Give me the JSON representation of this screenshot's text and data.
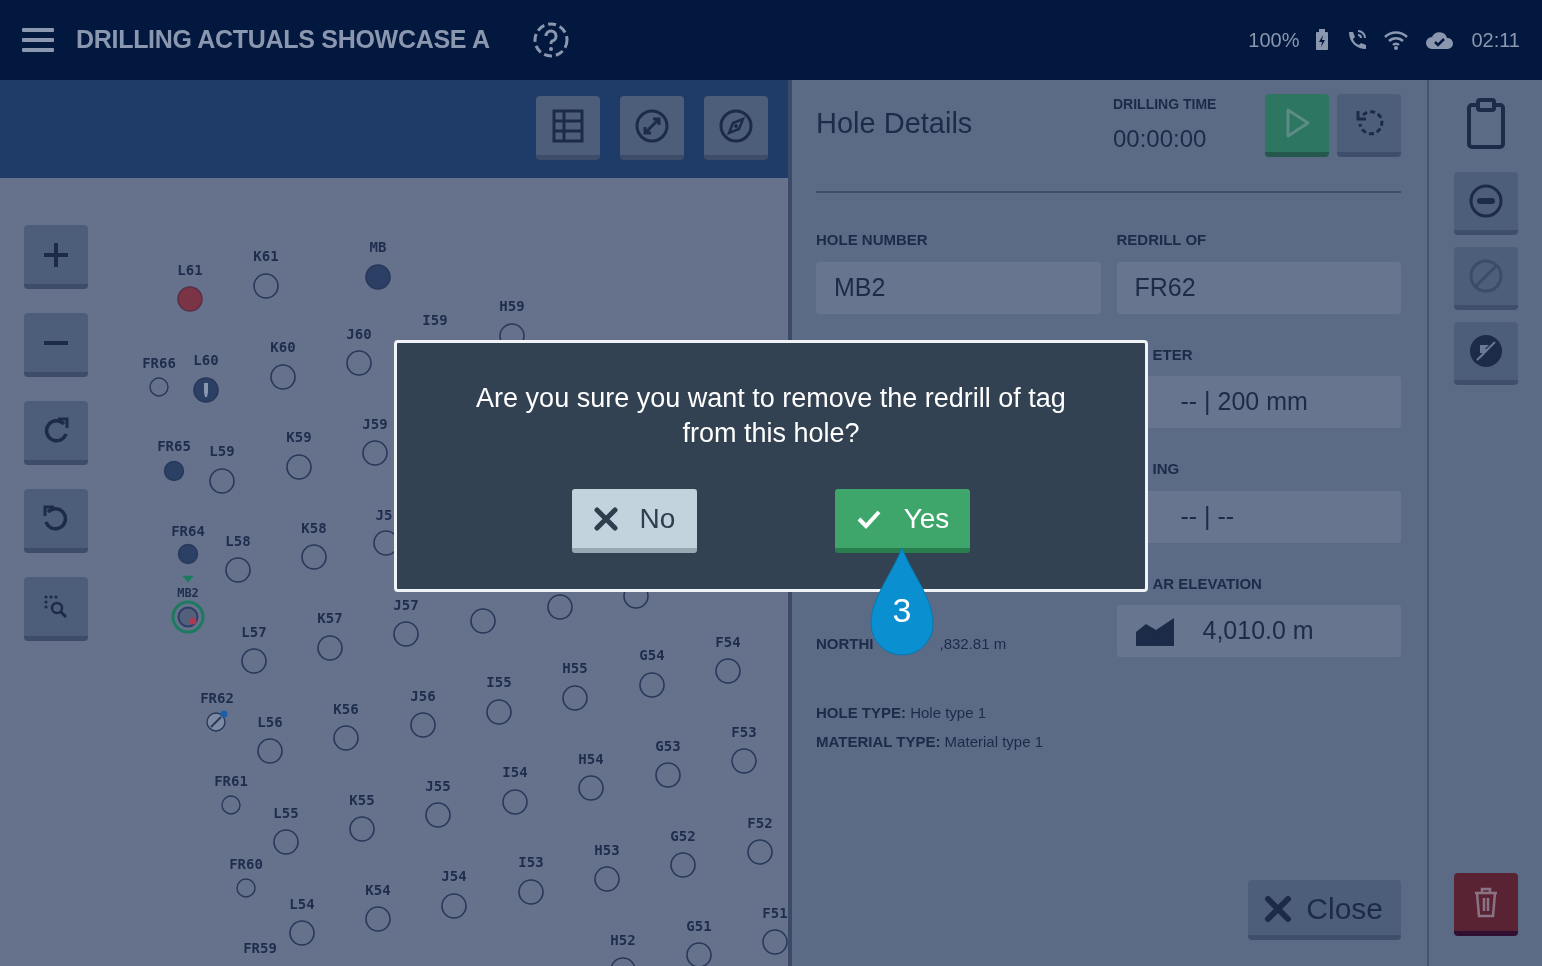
{
  "top_bar": {
    "title": "DRILLING ACTUALS SHOWCASE A",
    "battery": "100%",
    "time": "02:11"
  },
  "map": {
    "holes": [
      {
        "label": "MB",
        "kind": "drilled",
        "selected": false
      },
      {
        "label": "K61",
        "kind": "planned",
        "selected": false
      },
      {
        "label": "L61",
        "kind": "problem",
        "selected": false
      },
      {
        "label": "H59",
        "kind": "planned",
        "selected": false
      },
      {
        "label": "I59",
        "kind": "hidden",
        "selected": false
      },
      {
        "label": "J60",
        "kind": "planned",
        "selected": false
      },
      {
        "label": "K60",
        "kind": "planned",
        "selected": false
      },
      {
        "label": "L60",
        "kind": "flagged",
        "selected": false
      },
      {
        "label": "FR66",
        "kind": "small",
        "selected": false
      },
      {
        "label": "J59",
        "kind": "planned",
        "selected": false
      },
      {
        "label": "K59",
        "kind": "planned",
        "selected": false
      },
      {
        "label": "FR65",
        "kind": "small-drilled",
        "selected": false
      },
      {
        "label": "L59",
        "kind": "planned",
        "selected": false
      },
      {
        "label": "J5",
        "kind": "planned",
        "selected": false
      },
      {
        "label": "K58",
        "kind": "planned",
        "selected": false
      },
      {
        "label": "FR64",
        "kind": "small-drilled",
        "selected": false
      },
      {
        "label": "L58",
        "kind": "planned",
        "selected": false
      },
      {
        "label": "MB2",
        "kind": "redrilled",
        "selected": true
      },
      {
        "kind": "planned",
        "selected": false
      },
      {
        "label": "J57",
        "kind": "planned",
        "selected": false
      },
      {
        "kind": "planned",
        "selected": false
      },
      {
        "label": "K57",
        "kind": "planned",
        "selected": false
      },
      {
        "kind": "planned",
        "selected": false
      },
      {
        "label": "L57",
        "kind": "planned",
        "selected": false
      },
      {
        "label": "F54",
        "kind": "planned",
        "selected": false
      },
      {
        "label": "G54",
        "kind": "planned",
        "selected": false
      },
      {
        "label": "H55",
        "kind": "planned",
        "selected": false
      },
      {
        "label": "I55",
        "kind": "planned",
        "selected": false
      },
      {
        "label": "J56",
        "kind": "planned",
        "selected": false
      },
      {
        "label": "FR62",
        "kind": "redrill",
        "selected": false
      },
      {
        "label": "K56",
        "kind": "planned",
        "selected": false
      },
      {
        "label": "L56",
        "kind": "planned",
        "selected": false
      },
      {
        "label": "F53",
        "kind": "planned",
        "selected": false
      },
      {
        "label": "G53",
        "kind": "planned",
        "selected": false
      },
      {
        "label": "H54",
        "kind": "planned",
        "selected": false
      },
      {
        "label": "I54",
        "kind": "planned",
        "selected": false
      },
      {
        "label": "FR61",
        "kind": "small",
        "selected": false
      },
      {
        "label": "J55",
        "kind": "planned",
        "selected": false
      },
      {
        "label": "K55",
        "kind": "planned",
        "selected": false
      },
      {
        "label": "L55",
        "kind": "planned",
        "selected": false
      },
      {
        "label": "F52",
        "kind": "planned",
        "selected": false
      },
      {
        "label": "G52",
        "kind": "planned",
        "selected": false
      },
      {
        "label": "H53",
        "kind": "planned",
        "selected": false
      },
      {
        "label": "I53",
        "kind": "planned",
        "selected": false
      },
      {
        "label": "FR60",
        "kind": "small",
        "selected": false
      },
      {
        "label": "J54",
        "kind": "planned",
        "selected": false
      },
      {
        "label": "K54",
        "kind": "planned",
        "selected": false
      },
      {
        "label": "L54",
        "kind": "planned",
        "selected": false
      },
      {
        "label": "F51",
        "kind": "planned",
        "selected": false
      },
      {
        "label": "G51",
        "kind": "planned",
        "selected": false
      },
      {
        "label": "H52",
        "kind": "planned",
        "selected": false
      },
      {
        "label": "FR59",
        "kind": "hidden",
        "selected": false
      }
    ]
  },
  "hole_details": {
    "title": "Hole Details",
    "drilling_time_label": "DRILLING TIME",
    "drilling_time": "00:00:00",
    "fields": [
      {
        "label": "HOLE NUMBER",
        "value": "MB2"
      },
      {
        "label": "REDRILL OF",
        "value": "FR62"
      }
    ],
    "partial_fields": [
      {
        "label": "ETER",
        "value": "-- | 200 mm",
        "kind": "plain"
      },
      {
        "label": "ING",
        "value": "-- | --",
        "kind": "plain"
      },
      {
        "label": "AR ELEVATION",
        "value": "4,010.0 m",
        "kind": "elevation"
      }
    ],
    "northing": {
      "label": "NORTHI",
      "value": ",832.81 m"
    },
    "info": [
      "**HOLE TYPE:** Hole type 1",
      "**MATERIAL TYPE:** Material type 1"
    ],
    "close_button": "Close"
  },
  "rail": {
    "buttons": [
      {
        "kind": "remove",
        "disabled": false
      },
      {
        "kind": "block",
        "disabled": true
      },
      {
        "kind": "no-drill",
        "disabled": false
      }
    ]
  },
  "dialog": {
    "message": "Are you sure you want to remove the redrill of tag from this hole?",
    "no_button": "No",
    "yes_button": "Yes"
  },
  "step_marker": "3"
}
